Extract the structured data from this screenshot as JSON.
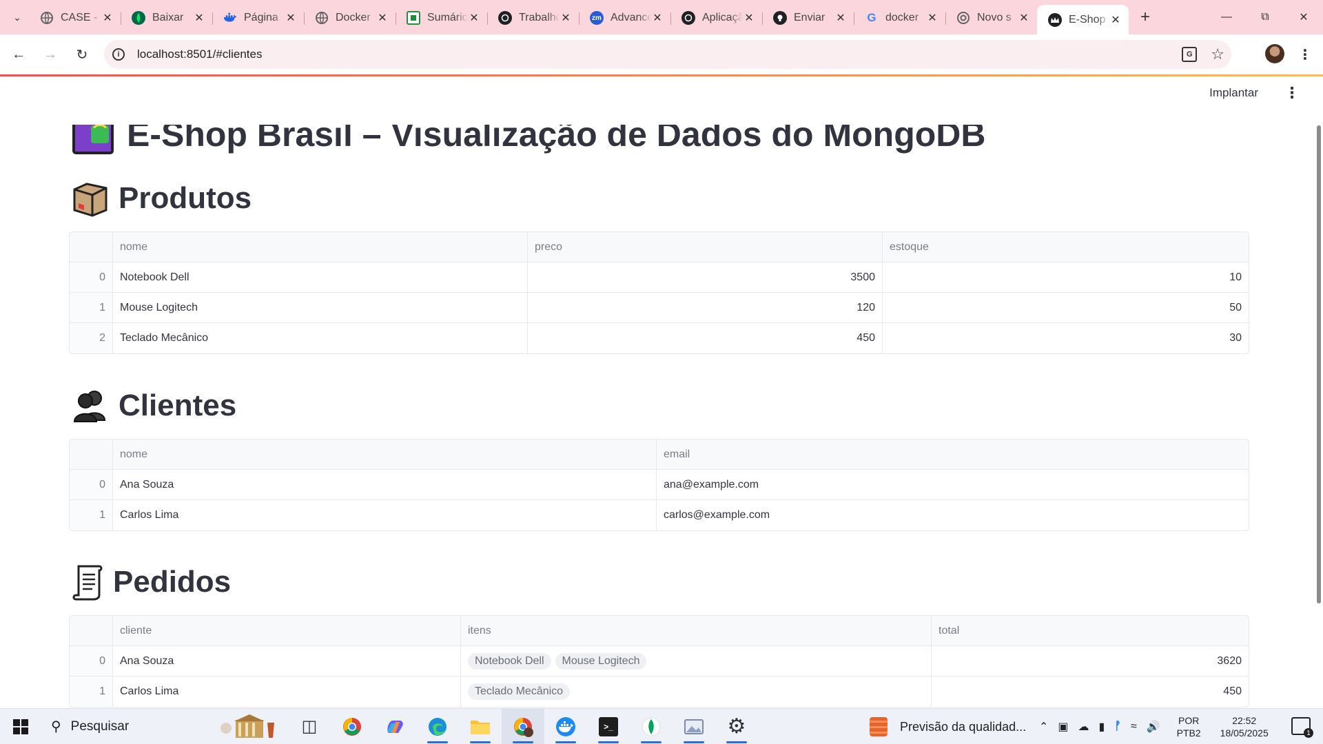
{
  "browser": {
    "tabs": [
      {
        "title": "CASE -",
        "icon": "globe-icon",
        "color": "#5f6368"
      },
      {
        "title": "Baixar",
        "icon": "mongodb-leaf-icon",
        "color": "#00684a"
      },
      {
        "title": "Página",
        "icon": "docker-whale-icon",
        "color": "#1d63ed"
      },
      {
        "title": "Docker",
        "icon": "globe-icon",
        "color": "#5f6368"
      },
      {
        "title": "Sumário",
        "icon": "document-icon",
        "color": "#1e8e3e"
      },
      {
        "title": "Trabalho",
        "icon": "openai-icon",
        "color": "#202124"
      },
      {
        "title": "Advanced",
        "icon": "zm-icon",
        "color": "#2a5bd7"
      },
      {
        "title": "Aplicação",
        "icon": "openai-icon",
        "color": "#202124"
      },
      {
        "title": "Enviar",
        "icon": "github-icon",
        "color": "#202124"
      },
      {
        "title": "docker",
        "icon": "google-icon",
        "color": "#4285f4"
      },
      {
        "title": "Novo s",
        "icon": "chrome-icon",
        "color": "#5f6368"
      },
      {
        "title": "E-Shop",
        "icon": "streamlit-crown-icon",
        "color": "#202124",
        "active": true
      }
    ],
    "url": "localhost:8501/#clientes"
  },
  "app": {
    "deploy_label": "Implantar",
    "title": "E-Shop Brasil – Visualização de Dados do MongoDB",
    "sections": {
      "produtos": {
        "heading": "Produtos",
        "columns": [
          "nome",
          "preco",
          "estoque"
        ],
        "rows": [
          {
            "index": "0",
            "nome": "Notebook Dell",
            "preco": "3500",
            "estoque": "10"
          },
          {
            "index": "1",
            "nome": "Mouse Logitech",
            "preco": "120",
            "estoque": "50"
          },
          {
            "index": "2",
            "nome": "Teclado Mecânico",
            "preco": "450",
            "estoque": "30"
          }
        ]
      },
      "clientes": {
        "heading": "Clientes",
        "columns": [
          "nome",
          "email"
        ],
        "rows": [
          {
            "index": "0",
            "nome": "Ana Souza",
            "email": "ana@example.com"
          },
          {
            "index": "1",
            "nome": "Carlos Lima",
            "email": "carlos@example.com"
          }
        ]
      },
      "pedidos": {
        "heading": "Pedidos",
        "columns": [
          "cliente",
          "itens",
          "total"
        ],
        "rows": [
          {
            "index": "0",
            "cliente": "Ana Souza",
            "itens": [
              "Notebook Dell",
              "Mouse Logitech"
            ],
            "total": "3620"
          },
          {
            "index": "1",
            "cliente": "Carlos Lima",
            "itens": [
              "Teclado Mecânico"
            ],
            "total": "450"
          }
        ]
      }
    }
  },
  "taskbar": {
    "search_placeholder": "Pesquisar",
    "weather_text": "Previsão da qualidad...",
    "language": "POR",
    "keyboard": "PTB2",
    "time": "22:52",
    "date": "18/05/2025",
    "notification_count": "1"
  }
}
